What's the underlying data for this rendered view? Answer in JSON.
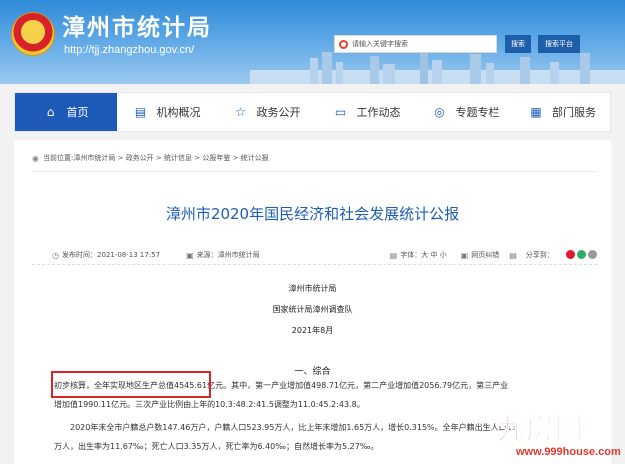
{
  "header": {
    "site_title": "漳州市统计局",
    "site_url": "http://tjj.zhangzhou.gov.cn/",
    "search_placeholder": "请输入关键字搜索",
    "search_button": "搜索",
    "search_platform_button": "搜索平台",
    "brand_color": "#1e5ea8"
  },
  "nav": {
    "items": [
      {
        "label": "首页",
        "icon": "home-icon",
        "active": true
      },
      {
        "label": "机构概况",
        "icon": "org-icon",
        "active": false
      },
      {
        "label": "政务公开",
        "icon": "star-icon",
        "active": false
      },
      {
        "label": "工作动态",
        "icon": "chat-icon",
        "active": false
      },
      {
        "label": "专题专栏",
        "icon": "lightbulb-icon",
        "active": false
      },
      {
        "label": "部门服务",
        "icon": "doc-icon",
        "active": false
      }
    ]
  },
  "breadcrumb": {
    "prefix": "当前位置:",
    "path": [
      "漳州市统计局",
      "政务公开",
      "统计信息",
      "公报年鉴",
      "统计公报"
    ]
  },
  "article": {
    "title": "漳州市2020年国民经济和社会发展统计公报",
    "published_label": "发布时间：2021-08-13 17:57",
    "source_label": "来源：漳州市统计局",
    "font_label": "字体：",
    "font_sizes": [
      "大",
      "中",
      "小"
    ],
    "error_report": "网页纠错",
    "share_label": "分享到：",
    "org_1": "漳州市统计局",
    "org_2": "国家统计局漳州调查队",
    "date": "2021年8月",
    "section_1": "一、综合",
    "para_1_line_1": "初步核算，全年实现地区生产总值4545.61亿元。其中，第一产业增加值498.71亿元，第二产业增加值2056.79亿元，第三产业",
    "para_1_line_2": "增加值1990.11亿元。三次产业比例由上年的10.3:48.2:41.5调整为11.0:45.2:43.8。",
    "para_2_line_1": "2020年末全市户籍总户数147.46万户，户籍人口523.95万人，比上年末增加1.65万人，增长0.315%。全年户籍出生人口11",
    "para_2_line_2": "万人，出生率为11.67‰；死亡人口3.35万人，死亡率为6.40‰；自然增长率为5.27‰。"
  },
  "watermark": {
    "main": "九房网",
    "sub": "www.999house.com"
  }
}
